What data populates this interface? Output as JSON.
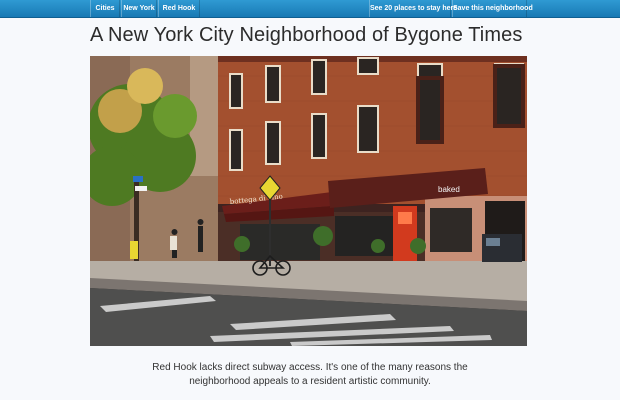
{
  "nav": {
    "cities": "Cities",
    "new_york": "New York",
    "red_hook": "Red Hook",
    "places": "See 20 places to stay here",
    "save": "Save this neighborhood"
  },
  "page": {
    "title": "A New York City Neighborhood of Bygone Times",
    "caption_line1": "Red Hook lacks direct subway access. It's one of the many reasons the",
    "caption_line2": "neighborhood appeals to a resident artistic community."
  },
  "photo": {
    "sign_bar": "bottega di vino",
    "sign_bakery": "baked"
  },
  "colors": {
    "nav_bar": "#1f86c2",
    "brick": "#a3502f",
    "awning": "#6b1e1a",
    "door": "#d23a1e"
  }
}
